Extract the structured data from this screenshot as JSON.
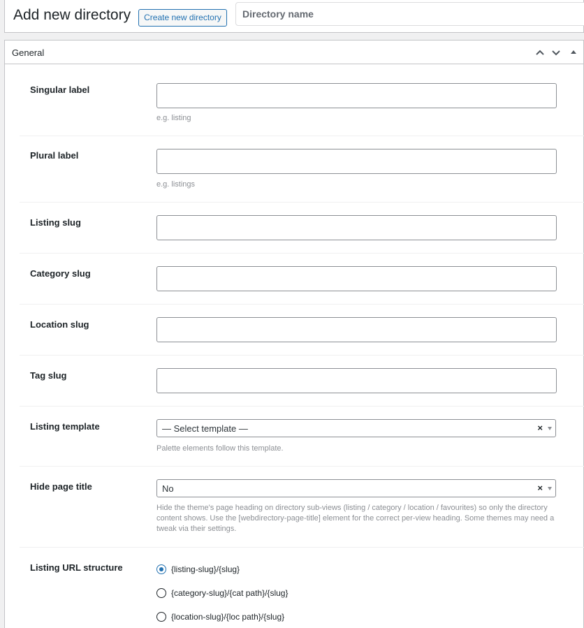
{
  "header": {
    "title": "Add new directory",
    "create_button": "Create new directory",
    "name_placeholder": "Directory name"
  },
  "panel": {
    "title": "General",
    "icons": [
      "chevron-up-icon",
      "chevron-down-icon",
      "collapse-triangle-icon"
    ]
  },
  "fields": {
    "singular": {
      "label": "Singular label",
      "value": "",
      "hint": "e.g. listing"
    },
    "plural": {
      "label": "Plural label",
      "value": "",
      "hint": "e.g. listings"
    },
    "listing_slug": {
      "label": "Listing slug",
      "value": ""
    },
    "category_slug": {
      "label": "Category slug",
      "value": ""
    },
    "location_slug": {
      "label": "Location slug",
      "value": ""
    },
    "tag_slug": {
      "label": "Tag slug",
      "value": ""
    },
    "listing_template": {
      "label": "Listing template",
      "value": "— Select template —",
      "clear": "×",
      "hint": "Palette elements follow this template."
    },
    "hide_page_title": {
      "label": "Hide page title",
      "value": "No",
      "clear": "×",
      "hint": "Hide the theme's page heading on directory sub-views (listing / category / location / favourites) so only the directory content shows. Use the [webdirectory-page-title] element for the correct per-view heading. Some themes may need a tweak via their settings."
    },
    "url_structure": {
      "label": "Listing URL structure",
      "selected": 0,
      "options": [
        "{listing-slug}/{slug}",
        "{category-slug}/{cat path}/{slug}",
        "{location-slug}/{loc path}/{slug}"
      ]
    }
  }
}
